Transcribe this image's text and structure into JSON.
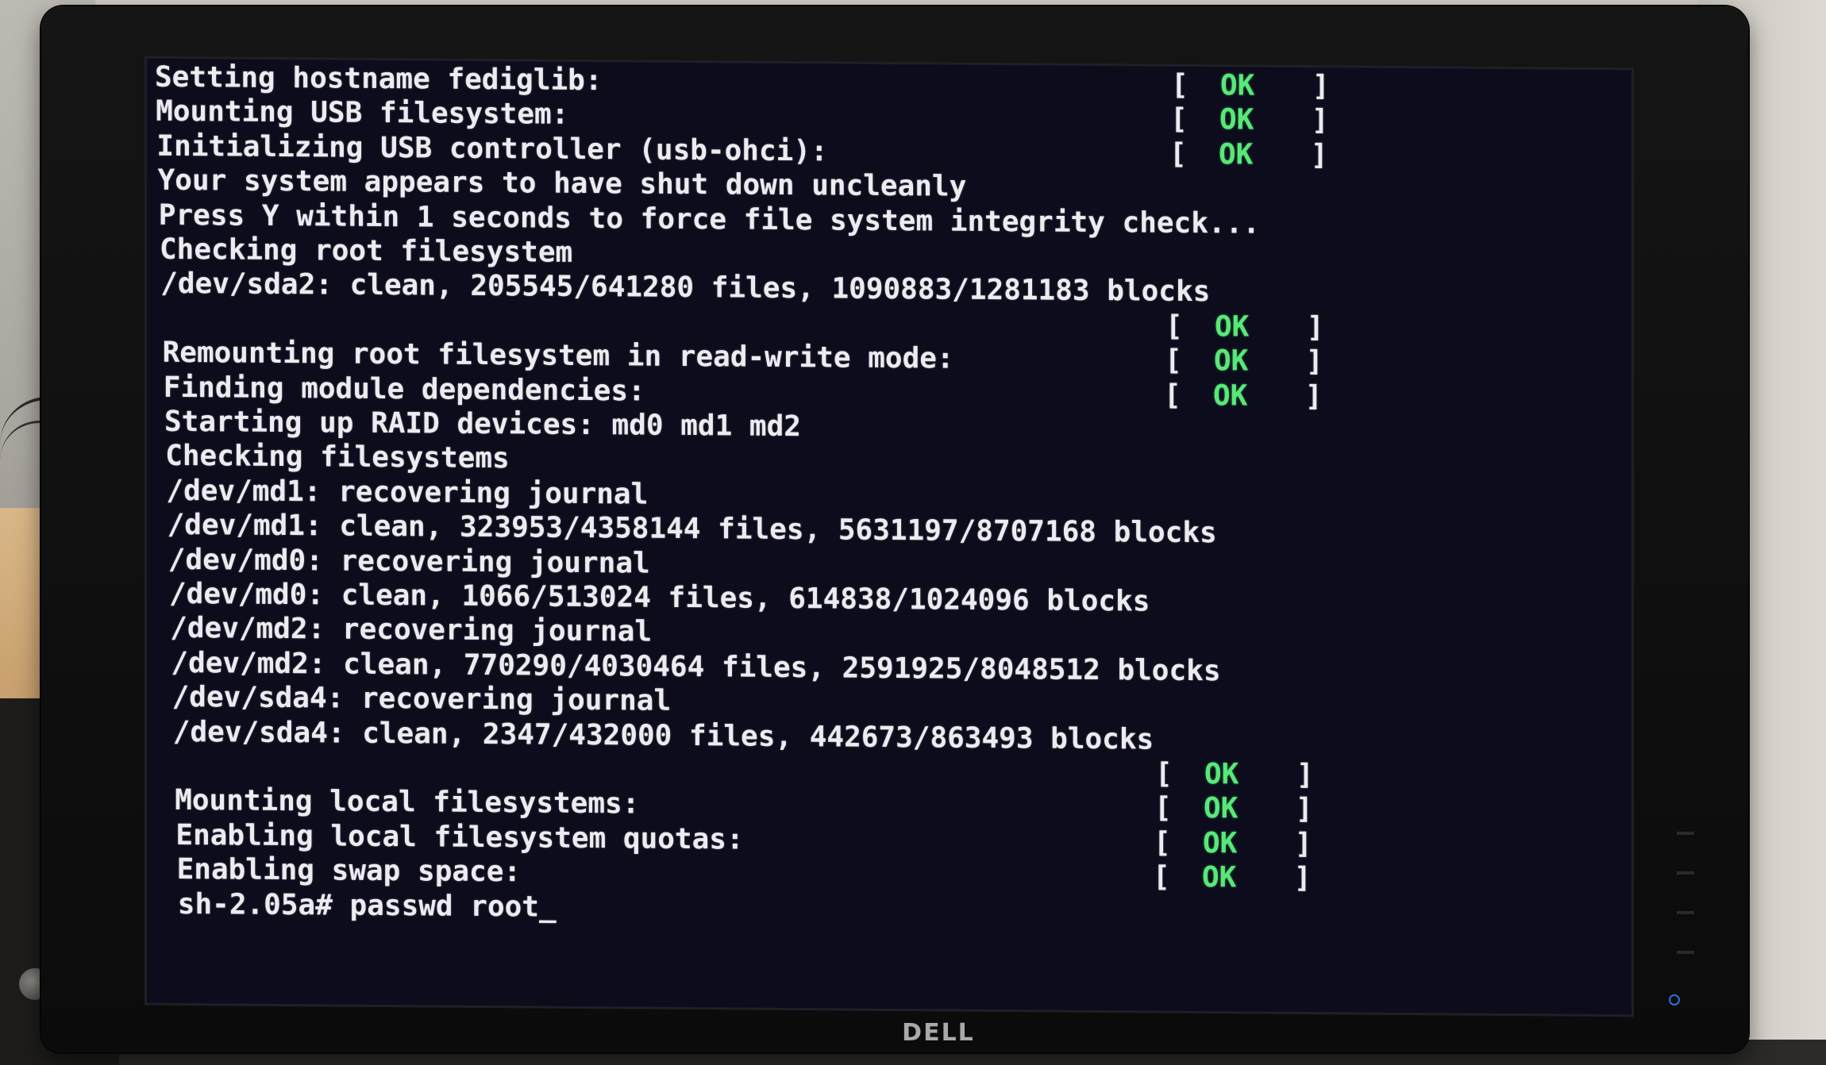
{
  "monitor": {
    "brand": "DELL"
  },
  "console": {
    "lines": [
      {
        "text": "Setting hostname fediglib:",
        "status": "OK"
      },
      {
        "text": "Mounting USB filesystem:",
        "status": "OK"
      },
      {
        "text": "Initializing USB controller (usb-ohci):",
        "status": "OK"
      },
      {
        "text": "Your system appears to have shut down uncleanly",
        "status": ""
      },
      {
        "text": "Press Y within 1 seconds to force file system integrity check...",
        "status": ""
      },
      {
        "text": "Checking root filesystem",
        "status": ""
      },
      {
        "text": "/dev/sda2: clean, 205545/641280 files, 1090883/1281183 blocks",
        "status": ""
      },
      {
        "text": "",
        "status": "OK"
      },
      {
        "text": "Remounting root filesystem in read-write mode:",
        "status": "OK"
      },
      {
        "text": "Finding module dependencies:",
        "status": "OK"
      },
      {
        "text": "Starting up RAID devices: md0 md1 md2",
        "status": ""
      },
      {
        "text": "Checking filesystems",
        "status": ""
      },
      {
        "text": "/dev/md1: recovering journal",
        "status": ""
      },
      {
        "text": "/dev/md1: clean, 323953/4358144 files, 5631197/8707168 blocks",
        "status": ""
      },
      {
        "text": "/dev/md0: recovering journal",
        "status": ""
      },
      {
        "text": "/dev/md0: clean, 1066/513024 files, 614838/1024096 blocks",
        "status": ""
      },
      {
        "text": "/dev/md2: recovering journal",
        "status": ""
      },
      {
        "text": "/dev/md2: clean, 770290/4030464 files, 2591925/8048512 blocks",
        "status": ""
      },
      {
        "text": "/dev/sda4: recovering journal",
        "status": ""
      },
      {
        "text": "/dev/sda4: clean, 2347/432000 files, 442673/863493 blocks",
        "status": ""
      },
      {
        "text": "",
        "status": "OK"
      },
      {
        "text": "Mounting local filesystems:",
        "status": "OK"
      },
      {
        "text": "Enabling local filesystem quotas:",
        "status": "OK"
      },
      {
        "text": "Enabling swap space:",
        "status": "OK"
      }
    ],
    "status_bracket_open": "[",
    "status_bracket_close": "]",
    "prompt": "sh-2.05a# ",
    "input": "passwd root",
    "cursor": "_"
  }
}
